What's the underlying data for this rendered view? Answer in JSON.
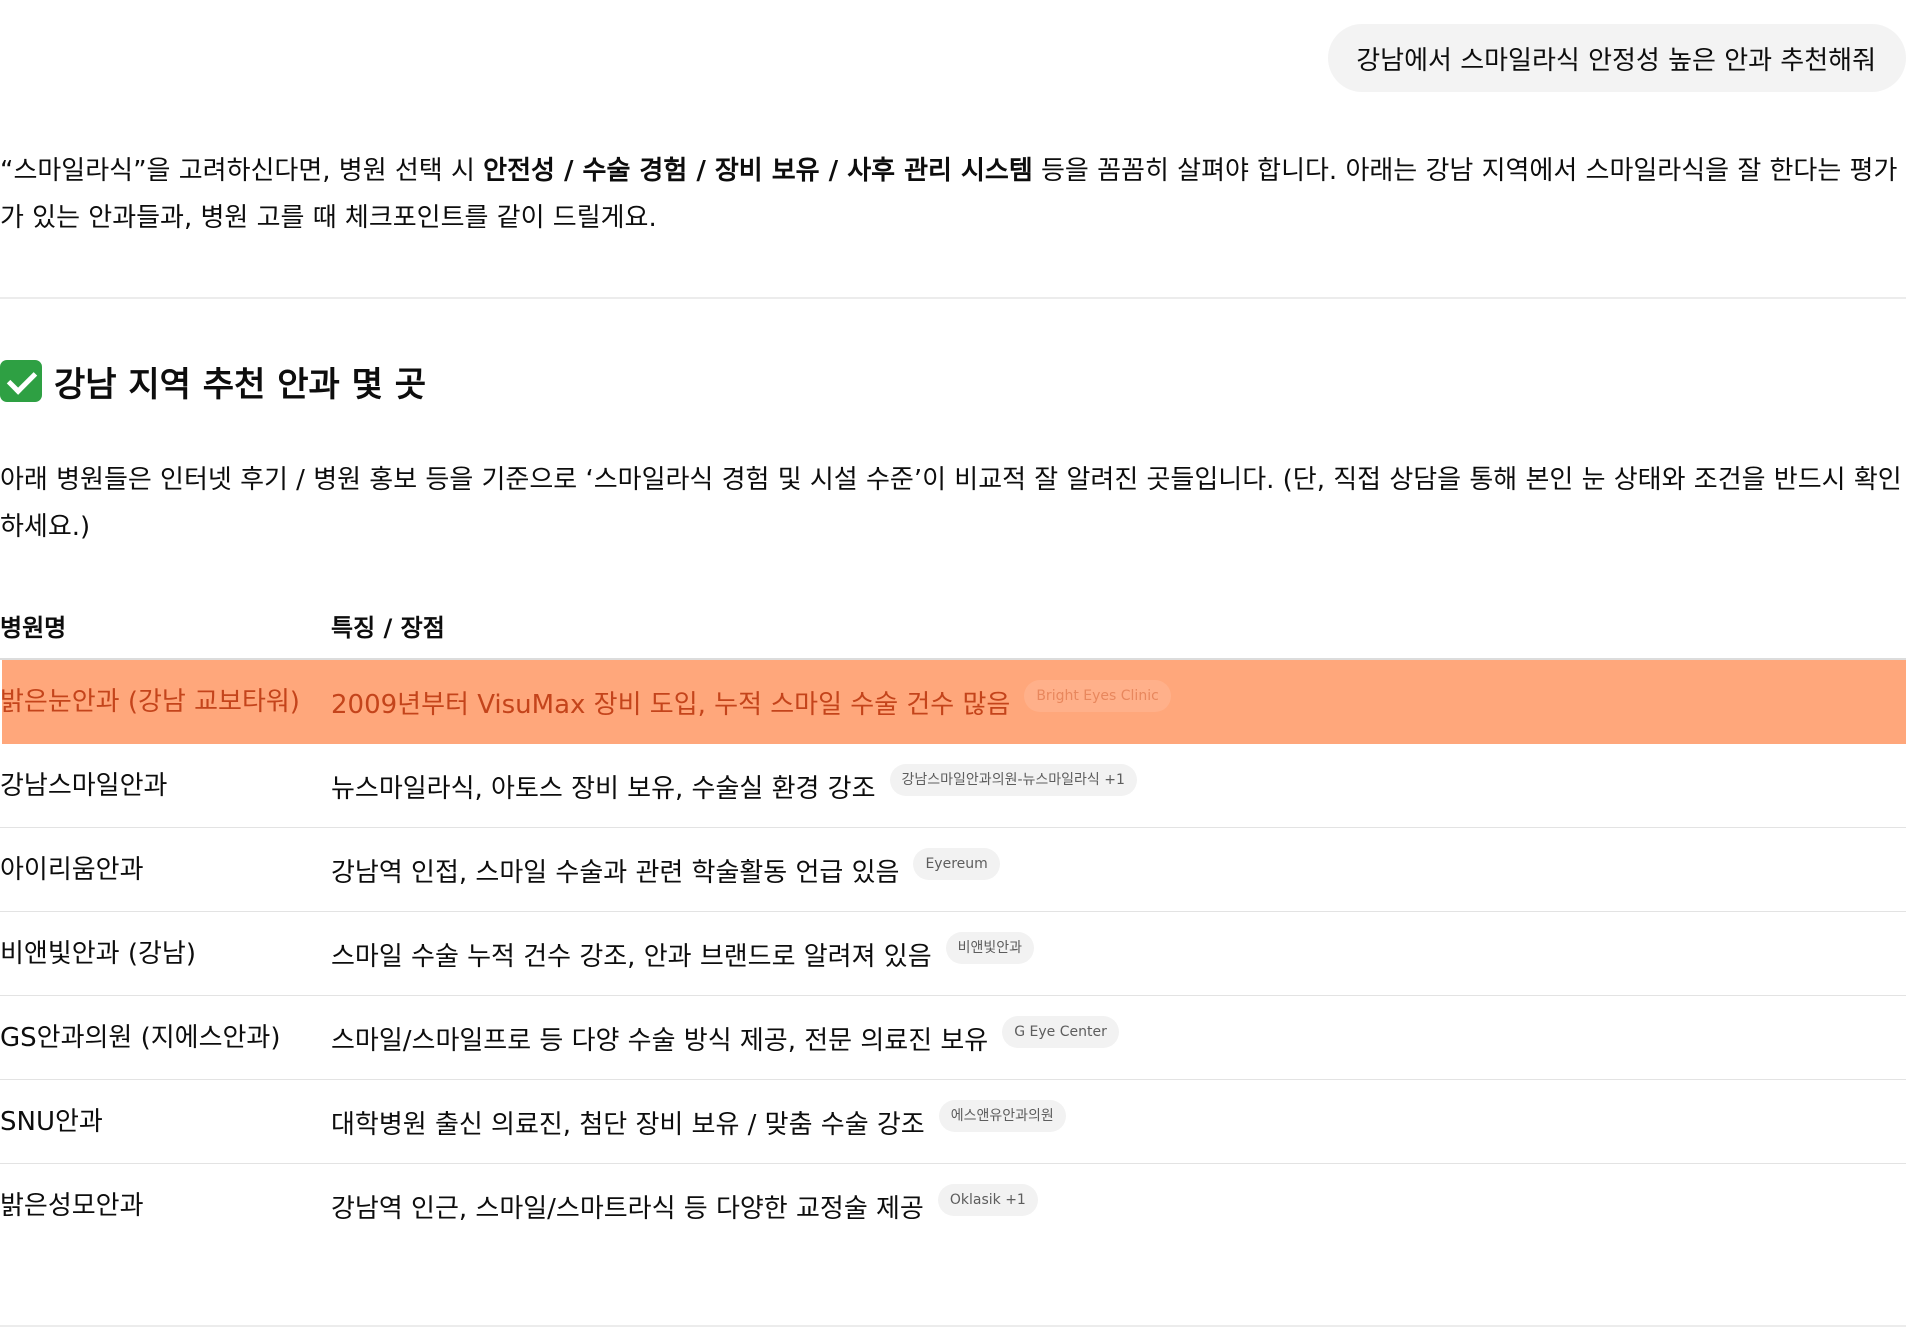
{
  "user_message": "강남에서 스마일라식 안정성 높은 안과 추천해줘",
  "intro": {
    "before": "“스마일라식”을 고려하신다면, 병원 선택 시 ",
    "bold": "안전성 / 수술 경험 / 장비 보유 / 사후 관리 시스템",
    "after": " 등을 꼼꼼히 살펴야 합니다. 아래는 강남 지역에서 스마일라식을 잘 한다는 평가가 있는 안과들과, 병원 고를 때 체크포인트를 같이 드릴게요."
  },
  "section": {
    "title": "강남 지역 추천 안과 몇 곳",
    "description": "아래 병원들은 인터넷 후기 / 병원 홍보 등을 기준으로 ‘스마일라식 경험 및 시설 수준’이 비교적 잘 알려진 곳들입니다. (단, 직접 상담을 통해 본인 눈 상태와 조건을 반드시 확인하세요.)"
  },
  "table": {
    "headers": [
      "병원명",
      "특징 / 장점"
    ],
    "rows": [
      {
        "name": "밝은눈안과 (강남 교보타워)",
        "features": "2009년부터 VisuMax 장비 도입, 누적 스마일 수술 건수 많음",
        "source": "Bright Eyes Clinic"
      },
      {
        "name": "강남스마일안과",
        "features": "뉴스마일라식, 아토스 장비 보유, 수술실 환경 강조",
        "source": "강남스마일안과의원-뉴스마일라식 +1"
      },
      {
        "name": "아이리움안과",
        "features": "강남역 인접, 스마일 수술과 관련 학술활동 언급 있음",
        "source": "Eyereum"
      },
      {
        "name": "비앤빛안과 (강남)",
        "features": "스마일 수술 누적 건수 강조, 안과 브랜드로 알려져 있음",
        "source": "비앤빛안과"
      },
      {
        "name": "GS안과의원 (지에스안과)",
        "features": "스마일/스마일프로 등 다양 수술 방식 제공, 전문 의료진 보유",
        "source": "G Eye Center"
      },
      {
        "name": "SNU안과",
        "features": "대학병원 출신 의료진, 첨단 장비 보유 / 맞춤 수술 강조",
        "source": "에스앤유안과의원"
      },
      {
        "name": "밝은성모안과",
        "features": "강남역 인근, 스마일/스마트라식 등 다양한 교정술 제공",
        "source": "Oklasik +1"
      }
    ]
  },
  "colors": {
    "highlight_row": "#ffa77b",
    "highlight_text": "#c4441b",
    "check_icon": "#2ea043"
  }
}
